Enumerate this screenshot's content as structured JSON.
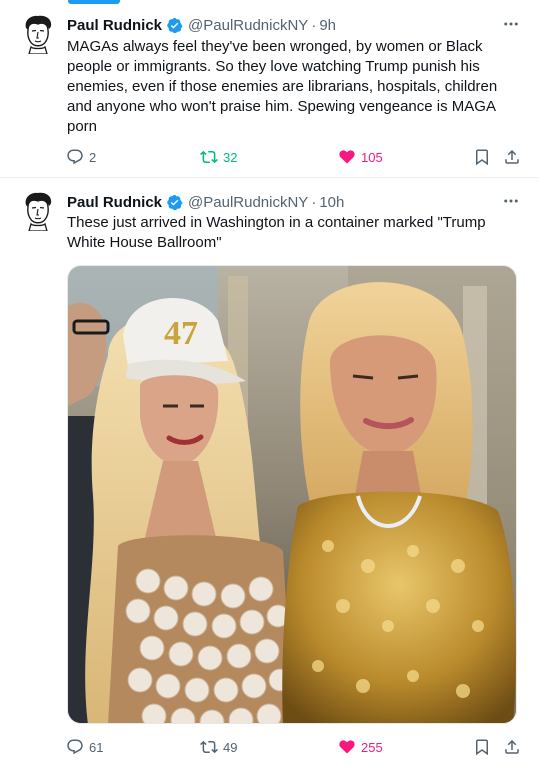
{
  "colors": {
    "accent": "#1d9bf0",
    "retweet_active": "#00ba7c",
    "like_active": "#f91880",
    "muted": "#536471"
  },
  "tweets": [
    {
      "author_name": "Paul Rudnick",
      "handle": "@PaulRudnickNY",
      "separator": "·",
      "time": "9h",
      "text": "MAGAs always feel they've been wronged, by women or Black\npeople or immigrants. So they love watching Trump punish his\nenemies, even if those enemies are librarians, hospitals, children\nand anyone who won't praise him. Spewing vengeance is MAGA\nporn",
      "replies": "2",
      "retweets": "32",
      "likes": "105",
      "icons": [
        "reply-icon",
        "retweet-icon",
        "heart-icon",
        "bookmark-icon",
        "share-icon",
        "more-icon",
        "verified-badge-icon"
      ]
    },
    {
      "author_name": "Paul Rudnick",
      "handle": "@PaulRudnickNY",
      "separator": "·",
      "time": "10h",
      "text": "These just arrived in Washington in a container marked \"Trump\nWhite House Ballroom\"",
      "photo_cap_text": "47",
      "replies": "61",
      "retweets": "49",
      "likes": "255",
      "icons": [
        "reply-icon",
        "retweet-icon",
        "heart-icon",
        "bookmark-icon",
        "share-icon",
        "more-icon",
        "verified-badge-icon"
      ]
    }
  ]
}
